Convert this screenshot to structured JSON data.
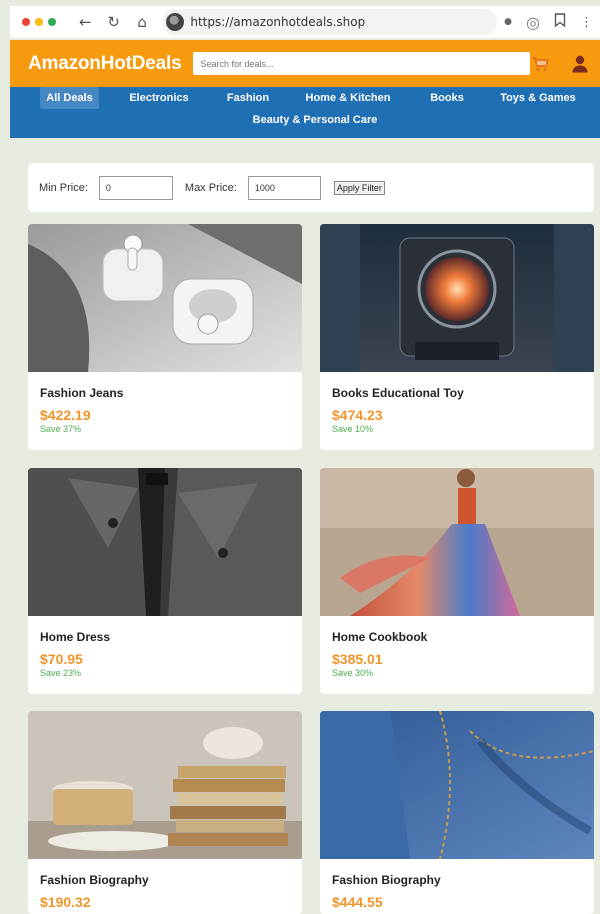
{
  "browser": {
    "url": "https://amazonhotdeals.shop",
    "dot_colors": [
      "#ea4335",
      "#fbbc05",
      "#34a853"
    ],
    "icons": [
      "back-arrow-icon",
      "reload-icon",
      "home-icon",
      "site-favicon",
      "record-dot-icon",
      "extension-spiral-icon",
      "bookmark-icon",
      "more-menu-icon"
    ]
  },
  "header": {
    "logo": "AmazonHotDeals",
    "search_placeholder": "Search for deals...",
    "brand_color": "#f79a0e",
    "icons": [
      "cart-icon",
      "user-icon"
    ]
  },
  "nav": {
    "color": "#1f6fb5",
    "categories": [
      "All Deals",
      "Electronics",
      "Fashion",
      "Home & Kitchen",
      "Books",
      "Toys & Games",
      "Beauty & Personal Care"
    ],
    "active": "All Deals"
  },
  "filter": {
    "min_label": "Min Price:",
    "min_value": "0",
    "max_label": "Max Price:",
    "max_value": "1000",
    "apply_label": "Apply Filter"
  },
  "products": [
    {
      "name": "Fashion Jeans",
      "price": "$422.19",
      "save": "Save 37%",
      "image": "wireless-earbuds-photo"
    },
    {
      "name": "Books Educational Toy",
      "price": "$474.23",
      "save": "Save 10%",
      "image": "sci-fi-machine-photo"
    },
    {
      "name": "Home Dress",
      "price": "$70.95",
      "save": "Save 23%",
      "image": "leather-jacket-photo"
    },
    {
      "name": "Home Cookbook",
      "price": "$385.01",
      "save": "Save 30%",
      "image": "colorful-dress-photo"
    },
    {
      "name": "Fashion Biography",
      "price": "$190.32",
      "save": "",
      "image": "books-and-cups-photo"
    },
    {
      "name": "Fashion Biography",
      "price": "$444.55",
      "save": "",
      "image": "denim-jeans-photo"
    }
  ]
}
